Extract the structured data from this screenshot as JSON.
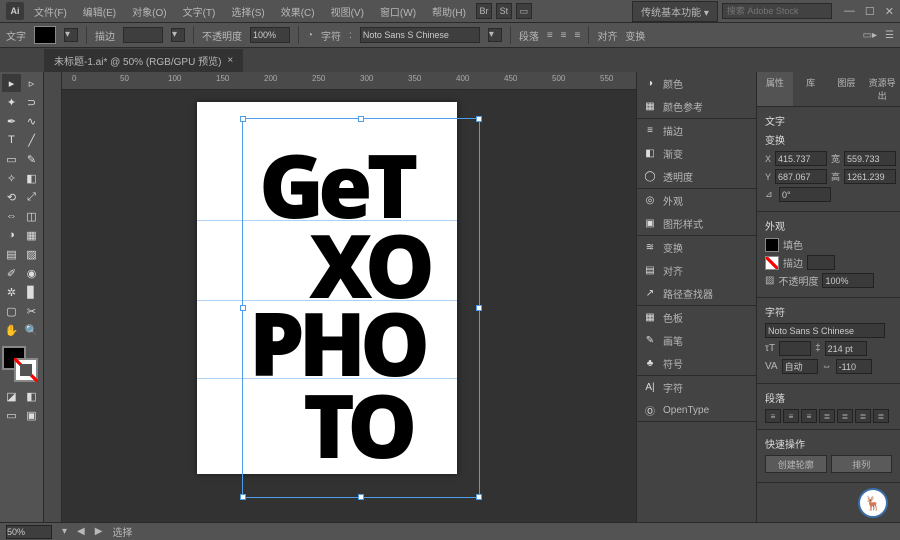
{
  "app": {
    "logo": "Ai"
  },
  "menu": {
    "items": [
      "文件(F)",
      "编辑(E)",
      "对象(O)",
      "文字(T)",
      "选择(S)",
      "效果(C)",
      "视图(V)",
      "窗口(W)",
      "帮助(H)"
    ],
    "workspace": "传统基本功能",
    "searchPlaceholder": "搜索 Adobe Stock"
  },
  "options": {
    "toolLabel": "文字",
    "strokeLabel": "描边",
    "strokeValue": "",
    "opacityLabel": "不透明度",
    "opacityValue": "100%",
    "fontFieldLabel": "字符",
    "fontName": "Noto Sans S Chinese",
    "paragraphLabel": "段落",
    "alignLabel": "对齐",
    "transformLabel": "变换"
  },
  "doc": {
    "tabTitle": "未标题-1.ai* @ 50% (RGB/GPU 预览)"
  },
  "rulerH": [
    "0",
    "50",
    "100",
    "150",
    "200",
    "250",
    "300",
    "350",
    "400",
    "450",
    "500",
    "550"
  ],
  "art": {
    "l1": "GeT",
    "l2": "XO",
    "l3": "PHO",
    "l4": "TO"
  },
  "midPanels": {
    "g1": [
      {
        "icon": "◑",
        "label": "颜色"
      },
      {
        "icon": "▦",
        "label": "颜色参考"
      }
    ],
    "g2": [
      {
        "icon": "≡",
        "label": "描边"
      },
      {
        "icon": "◧",
        "label": "渐变"
      },
      {
        "icon": "◯",
        "label": "透明度"
      }
    ],
    "g3": [
      {
        "icon": "◎",
        "label": "外观"
      },
      {
        "icon": "▣",
        "label": "图形样式"
      }
    ],
    "g4": [
      {
        "icon": "≋",
        "label": "变换"
      },
      {
        "icon": "▤",
        "label": "对齐"
      },
      {
        "icon": "↗",
        "label": "路径查找器"
      }
    ],
    "g5": [
      {
        "icon": "▦",
        "label": "色板"
      },
      {
        "icon": "✎",
        "label": "画笔"
      },
      {
        "icon": "♣",
        "label": "符号"
      }
    ],
    "g6": [
      {
        "icon": "A|",
        "label": "字符"
      },
      {
        "icon": "Ⓞ",
        "label": "OpenType"
      }
    ]
  },
  "rp": {
    "tabs": [
      "属性",
      "库",
      "图层",
      "资源导出"
    ],
    "objType": "文字",
    "transform": {
      "title": "变换",
      "x": "415.737",
      "w": "559.733",
      "y": "687.067",
      "h": "1261.239",
      "rotate": "0°"
    },
    "appearance": {
      "title": "外观",
      "fill": "填色",
      "stroke": "描边",
      "opacityLabel": "不透明度",
      "opacityValue": "100%"
    },
    "character": {
      "title": "字符",
      "font": "Noto Sans S Chinese",
      "size": "214 pt",
      "kernMode": "自动",
      "kernVal": "-110"
    },
    "paragraph": {
      "title": "段落"
    },
    "quick": {
      "title": "快速操作",
      "btn1": "创建轮廓",
      "btn2": "排列"
    }
  },
  "status": {
    "zoom": "50%",
    "toolState": "选择"
  }
}
